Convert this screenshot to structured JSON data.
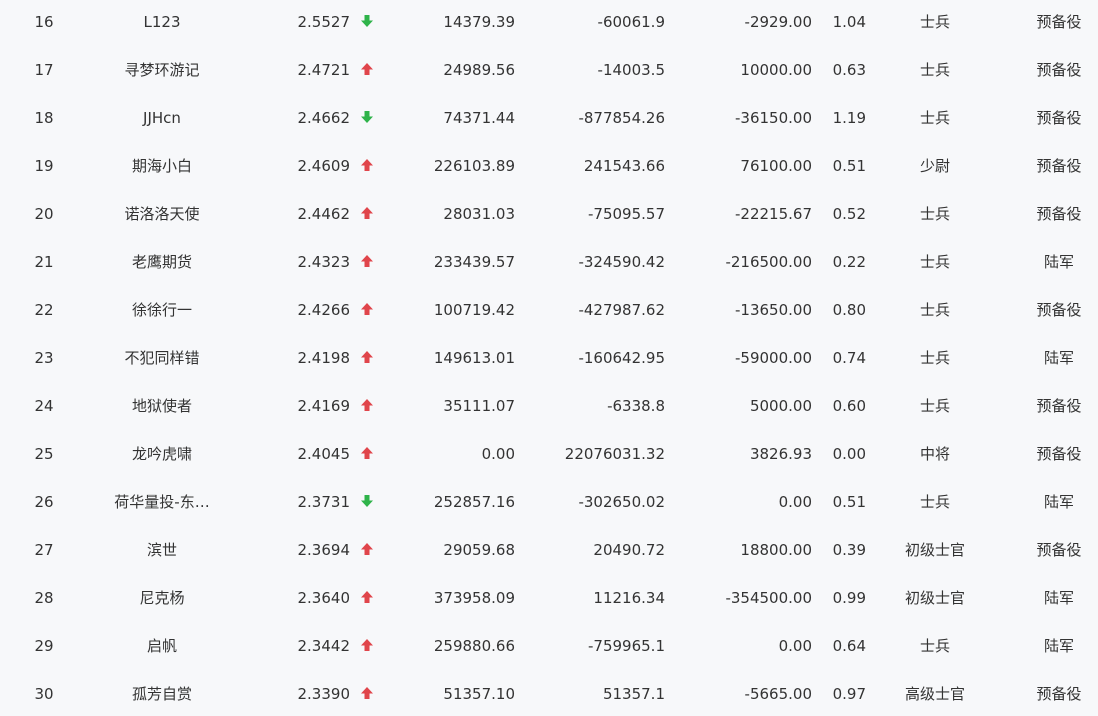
{
  "colors": {
    "background": "#f7f8fa",
    "text": "#333333",
    "up": "#e0454b",
    "down": "#2fb34a"
  },
  "rows": [
    {
      "rank": "16",
      "name": "L123",
      "score": "2.5527",
      "trend": "down",
      "trend_icon": "arrow-down-icon",
      "v1": "14379.39",
      "v2": "-60061.9",
      "v3": "-2929.00",
      "v4": "1.04",
      "title": "士兵",
      "unit": "预备役"
    },
    {
      "rank": "17",
      "name": "寻梦环游记",
      "score": "2.4721",
      "trend": "up",
      "trend_icon": "arrow-up-icon",
      "v1": "24989.56",
      "v2": "-14003.5",
      "v3": "10000.00",
      "v4": "0.63",
      "title": "士兵",
      "unit": "预备役"
    },
    {
      "rank": "18",
      "name": "JJHcn",
      "score": "2.4662",
      "trend": "down",
      "trend_icon": "arrow-down-icon",
      "v1": "74371.44",
      "v2": "-877854.26",
      "v3": "-36150.00",
      "v4": "1.19",
      "title": "士兵",
      "unit": "预备役"
    },
    {
      "rank": "19",
      "name": "期海小白",
      "score": "2.4609",
      "trend": "up",
      "trend_icon": "arrow-up-icon",
      "v1": "226103.89",
      "v2": "241543.66",
      "v3": "76100.00",
      "v4": "0.51",
      "title": "少尉",
      "unit": "预备役"
    },
    {
      "rank": "20",
      "name": "诺洛洛天使",
      "score": "2.4462",
      "trend": "up",
      "trend_icon": "arrow-up-icon",
      "v1": "28031.03",
      "v2": "-75095.57",
      "v3": "-22215.67",
      "v4": "0.52",
      "title": "士兵",
      "unit": "预备役"
    },
    {
      "rank": "21",
      "name": "老鹰期货",
      "score": "2.4323",
      "trend": "up",
      "trend_icon": "arrow-up-icon",
      "v1": "233439.57",
      "v2": "-324590.42",
      "v3": "-216500.00",
      "v4": "0.22",
      "title": "士兵",
      "unit": "陆军"
    },
    {
      "rank": "22",
      "name": "徐徐行一",
      "score": "2.4266",
      "trend": "up",
      "trend_icon": "arrow-up-icon",
      "v1": "100719.42",
      "v2": "-427987.62",
      "v3": "-13650.00",
      "v4": "0.80",
      "title": "士兵",
      "unit": "预备役"
    },
    {
      "rank": "23",
      "name": "不犯同样错",
      "score": "2.4198",
      "trend": "up",
      "trend_icon": "arrow-up-icon",
      "v1": "149613.01",
      "v2": "-160642.95",
      "v3": "-59000.00",
      "v4": "0.74",
      "title": "士兵",
      "unit": "陆军"
    },
    {
      "rank": "24",
      "name": "地狱使者",
      "score": "2.4169",
      "trend": "up",
      "trend_icon": "arrow-up-icon",
      "v1": "35111.07",
      "v2": "-6338.8",
      "v3": "5000.00",
      "v4": "0.60",
      "title": "士兵",
      "unit": "预备役"
    },
    {
      "rank": "25",
      "name": "龙吟虎啸",
      "score": "2.4045",
      "trend": "up",
      "trend_icon": "arrow-up-icon",
      "v1": "0.00",
      "v2": "22076031.32",
      "v3": "3826.93",
      "v4": "0.00",
      "title": "中将",
      "unit": "预备役"
    },
    {
      "rank": "26",
      "name": "荷华量投-东…",
      "score": "2.3731",
      "trend": "down",
      "trend_icon": "arrow-down-icon",
      "v1": "252857.16",
      "v2": "-302650.02",
      "v3": "0.00",
      "v4": "0.51",
      "title": "士兵",
      "unit": "陆军"
    },
    {
      "rank": "27",
      "name": "滨世",
      "score": "2.3694",
      "trend": "up",
      "trend_icon": "arrow-up-icon",
      "v1": "29059.68",
      "v2": "20490.72",
      "v3": "18800.00",
      "v4": "0.39",
      "title": "初级士官",
      "unit": "预备役"
    },
    {
      "rank": "28",
      "name": "尼克杨",
      "score": "2.3640",
      "trend": "up",
      "trend_icon": "arrow-up-icon",
      "v1": "373958.09",
      "v2": "11216.34",
      "v3": "-354500.00",
      "v4": "0.99",
      "title": "初级士官",
      "unit": "陆军"
    },
    {
      "rank": "29",
      "name": "启帆",
      "score": "2.3442",
      "trend": "up",
      "trend_icon": "arrow-up-icon",
      "v1": "259880.66",
      "v2": "-759965.1",
      "v3": "0.00",
      "v4": "0.64",
      "title": "士兵",
      "unit": "陆军"
    },
    {
      "rank": "30",
      "name": "孤芳自赏",
      "score": "2.3390",
      "trend": "up",
      "trend_icon": "arrow-up-icon",
      "v1": "51357.10",
      "v2": "51357.1",
      "v3": "-5665.00",
      "v4": "0.97",
      "title": "高级士官",
      "unit": "预备役"
    }
  ]
}
